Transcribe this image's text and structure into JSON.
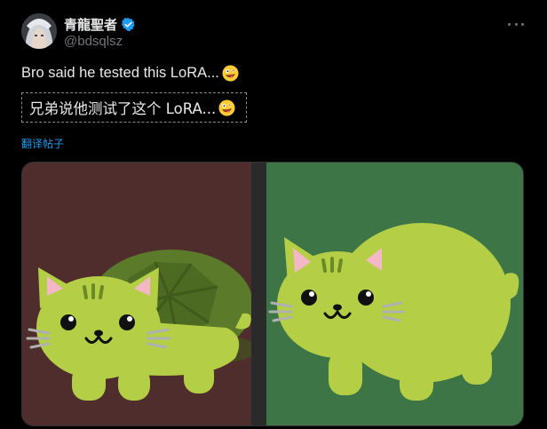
{
  "user": {
    "display_name": "青龍聖者",
    "handle": "@bdsqlsz",
    "verified": true,
    "avatar_icon": "avatar-anime-character"
  },
  "tweet": {
    "text": "Bro said he tested this LoRA...",
    "emoji": "zany-face",
    "translation": "兄弟说他测试了这个 LoRA...",
    "translate_link": "翻译帖子"
  },
  "media": {
    "left_image": "cat-turtle-with-shell",
    "right_image": "cat-turtle-without-shell"
  },
  "colors": {
    "background": "#000000",
    "text": "#e7e9ea",
    "muted": "#71767b",
    "link": "#1d9bf0",
    "verified": "#1d9bf0"
  }
}
